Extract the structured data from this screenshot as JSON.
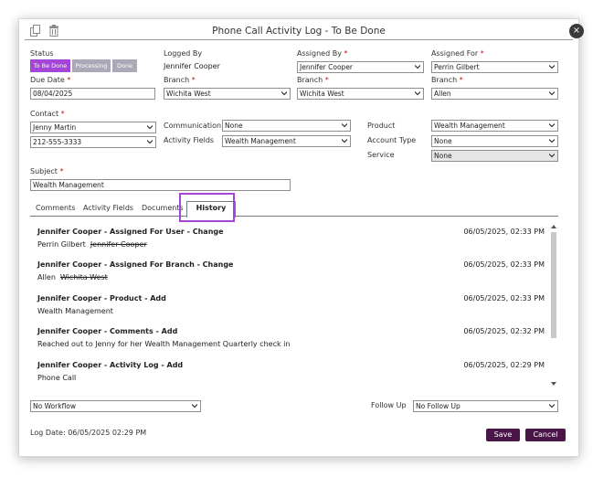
{
  "dialog": {
    "title": "Phone Call Activity Log - To Be Done",
    "close_glyph": "×"
  },
  "status": {
    "label": "Status",
    "buttons": [
      "To Be Done",
      "Processing",
      "Done"
    ],
    "active_color": "#a445d8",
    "inactive_color": "#a9a9b8"
  },
  "logged_by": {
    "label": "Logged By",
    "value": "Jennifer Cooper"
  },
  "assigned_by": {
    "label": "Assigned By",
    "value": "Jennifer Cooper"
  },
  "assigned_for": {
    "label": "Assigned For",
    "value": "Perrin Gilbert"
  },
  "due_date": {
    "label": "Due Date",
    "value": "08/04/2025"
  },
  "branch_logged": {
    "label": "Branch",
    "value": "Wichita West"
  },
  "branch_assigned_by": {
    "label": "Branch",
    "value": "Wichita West"
  },
  "branch_assigned_for": {
    "label": "Branch",
    "value": "Allen"
  },
  "contact": {
    "label": "Contact",
    "name": "Jenny Martin",
    "phone": "212-555-3333"
  },
  "communication": {
    "label": "Communication",
    "value": "None"
  },
  "activity_fields": {
    "label": "Activity Fields",
    "value": "Wealth Management"
  },
  "product": {
    "label": "Product",
    "value": "Wealth Management"
  },
  "account_type": {
    "label": "Account Type",
    "value": "None"
  },
  "service": {
    "label": "Service",
    "value": "None"
  },
  "subject": {
    "label": "Subject",
    "value": "Wealth Management"
  },
  "required_mark": "*",
  "tabs": [
    "Comments",
    "Activity Fields",
    "Documents",
    "History"
  ],
  "history": [
    {
      "title": "Jennifer Cooper - Assigned For User - Change",
      "time": "06/05/2025, 02:33 PM",
      "new": "Perrin Gilbert",
      "old": "Jennifer Cooper"
    },
    {
      "title": "Jennifer Cooper - Assigned For Branch - Change",
      "time": "06/05/2025, 02:33 PM",
      "new": "Allen",
      "old": "Wichita West"
    },
    {
      "title": "Jennifer Cooper - Product - Add",
      "time": "06/05/2025, 02:33 PM",
      "new": "Wealth Management",
      "old": ""
    },
    {
      "title": "Jennifer Cooper - Comments - Add",
      "time": "06/05/2025, 02:32 PM",
      "new": "Reached out to Jenny for her Wealth Management Quarterly check in",
      "old": ""
    },
    {
      "title": "Jennifer Cooper - Activity Log - Add",
      "time": "06/05/2025, 02:29 PM",
      "new": "Phone Call",
      "old": ""
    }
  ],
  "workflow": {
    "value": "No Workflow"
  },
  "follow_up": {
    "label": "Follow Up",
    "value": "No Follow Up"
  },
  "log_date": "Log Date: 06/05/2025  02:29 PM",
  "buttons": {
    "save": "Save",
    "cancel": "Cancel",
    "color": "#4a1648"
  },
  "icons": {
    "copy": "copy-icon",
    "delete": "trash-icon",
    "close": "close-icon",
    "dropdown": "chevron-down-icon"
  }
}
